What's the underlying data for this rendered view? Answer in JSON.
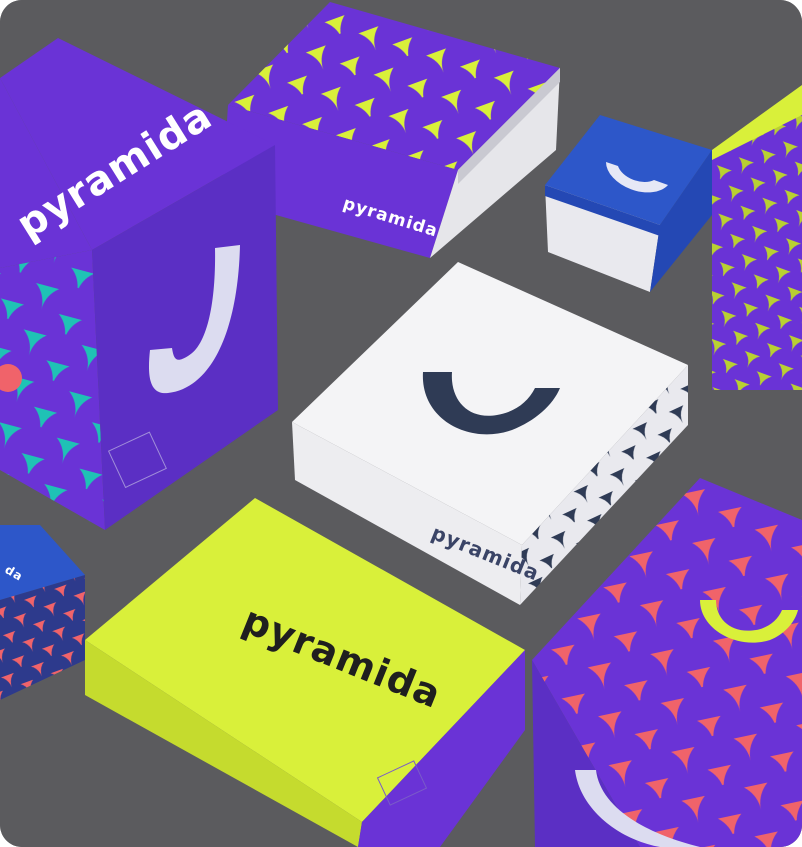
{
  "photo": {
    "subject": "product packaging boxes",
    "brand_text": "pyramida",
    "colors": {
      "background": "#5b5b5e",
      "purple": "#6a33d6",
      "purple_dark": "#5128b4",
      "lime": "#d9f03a",
      "lime_dark": "#b8cf27",
      "teal": "#1fc2b5",
      "coral": "#f0636a",
      "blue": "#2d57c9",
      "white": "#f4f4f6",
      "navy": "#2f3b55",
      "mark_light": "#dcdcf0"
    }
  },
  "boxes": {
    "big_purple_left_label": "pyramida",
    "purple_scale_top_label": "pyramida",
    "white_box_label": "pyramida",
    "lime_box_label": "pyramida"
  }
}
